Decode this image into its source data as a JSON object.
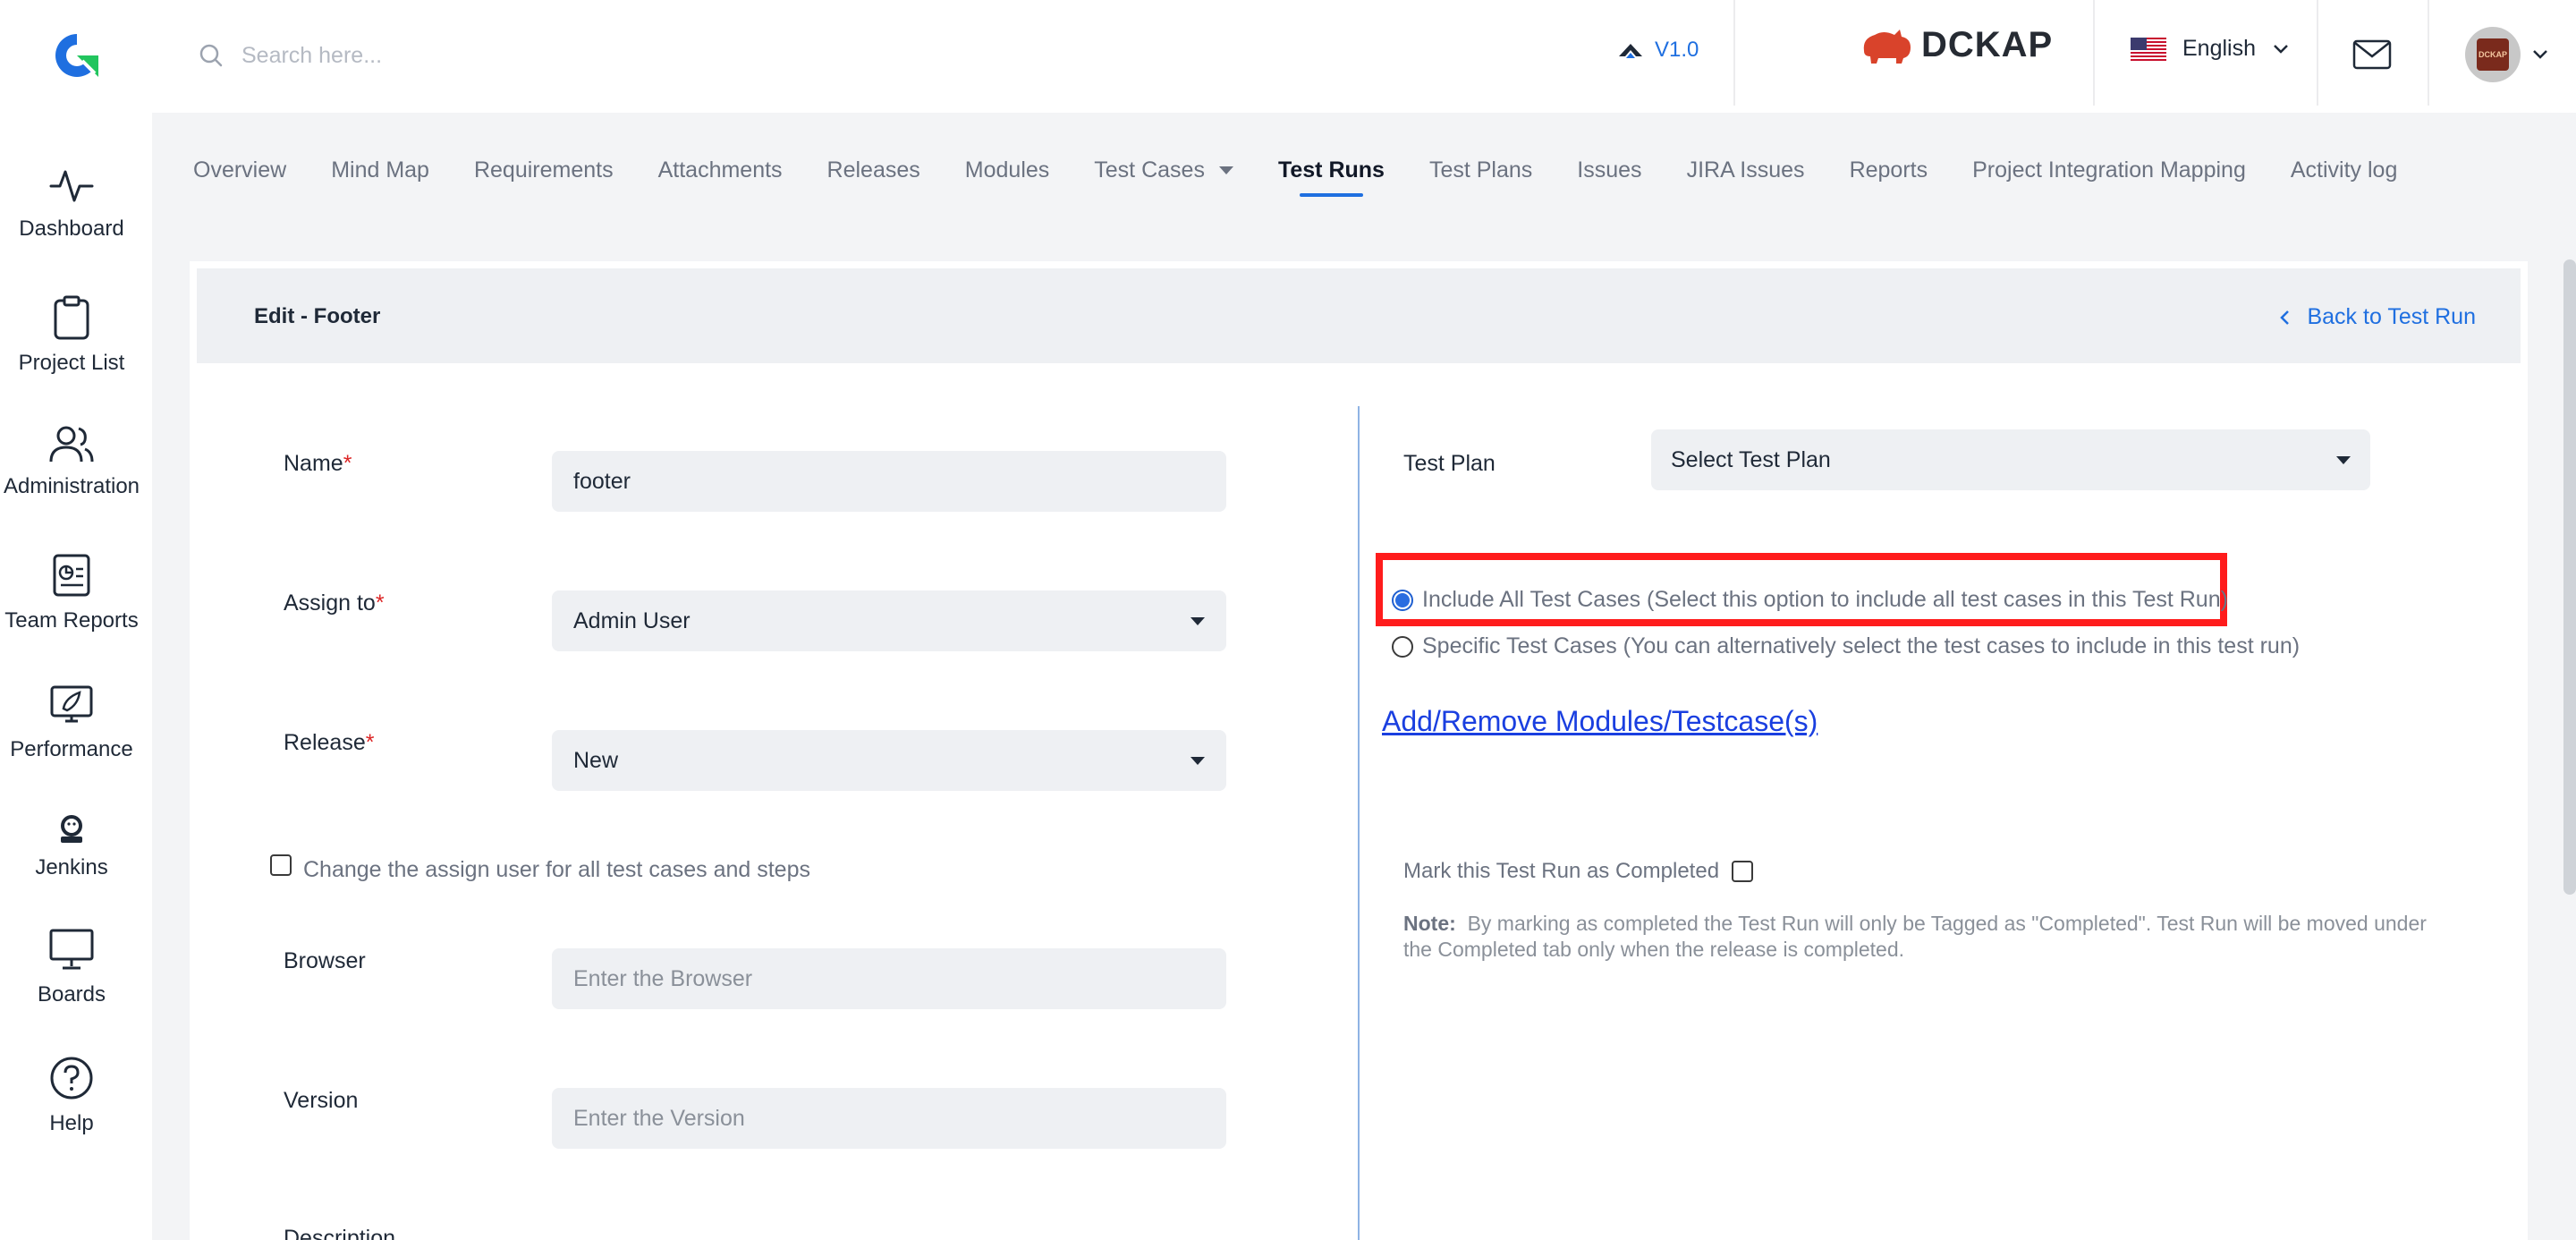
{
  "header": {
    "search_placeholder": "Search here...",
    "version": "V1.0",
    "brand": "DCKAP",
    "language": "English",
    "avatar_text": "DCKAP"
  },
  "sidebar": {
    "items": [
      {
        "label": "Dashboard",
        "icon": "activity-icon"
      },
      {
        "label": "Project List",
        "icon": "clipboard-icon"
      },
      {
        "label": "Administration",
        "icon": "users-icon"
      },
      {
        "label": "Team Reports",
        "icon": "report-icon"
      },
      {
        "label": "Performance",
        "icon": "rocket-icon"
      },
      {
        "label": "Jenkins",
        "icon": "jenkins-icon"
      },
      {
        "label": "Boards",
        "icon": "board-icon"
      },
      {
        "label": "Help",
        "icon": "help-icon"
      }
    ]
  },
  "tabs": [
    {
      "label": "Overview"
    },
    {
      "label": "Mind Map"
    },
    {
      "label": "Requirements"
    },
    {
      "label": "Attachments"
    },
    {
      "label": "Releases"
    },
    {
      "label": "Modules"
    },
    {
      "label": "Test Cases"
    },
    {
      "label": "Test Runs"
    },
    {
      "label": "Test Plans"
    },
    {
      "label": "Issues"
    },
    {
      "label": "JIRA Issues"
    },
    {
      "label": "Reports"
    },
    {
      "label": "Project Integration Mapping"
    },
    {
      "label": "Activity log"
    }
  ],
  "active_tab": "Test Runs",
  "page": {
    "title": "Edit - Footer",
    "back_link": "Back to Test Run"
  },
  "form": {
    "name_label": "Name",
    "name_value": "footer",
    "assign_label": "Assign to",
    "assign_value": "Admin User",
    "release_label": "Release",
    "release_value": "New",
    "change_assign_label": "Change the assign user for all test cases and steps",
    "browser_label": "Browser",
    "browser_placeholder": "Enter the Browser",
    "version_label": "Version",
    "version_placeholder": "Enter the Version",
    "description_label": "Description",
    "required_mark": "*"
  },
  "right": {
    "test_plan_label": "Test Plan",
    "test_plan_value": "Select Test Plan",
    "include_all_label": "Include All Test Cases (Select this option to include all test cases in this Test Run)",
    "specific_label": "Specific Test Cases (You can alternatively select the test cases to include in this test run)",
    "add_remove_link": "Add/Remove Modules/Testcase(s)",
    "mark_completed_label": "Mark this Test Run as Completed",
    "note_title": "Note:",
    "note_text": "By marking as completed the Test Run will only be Tagged as \"Completed\". Test Run will be moved under the Completed tab only when the release is completed."
  },
  "colors": {
    "accent": "#1f6fe0",
    "highlight": "#ff1c1c",
    "required": "#dc2626"
  }
}
